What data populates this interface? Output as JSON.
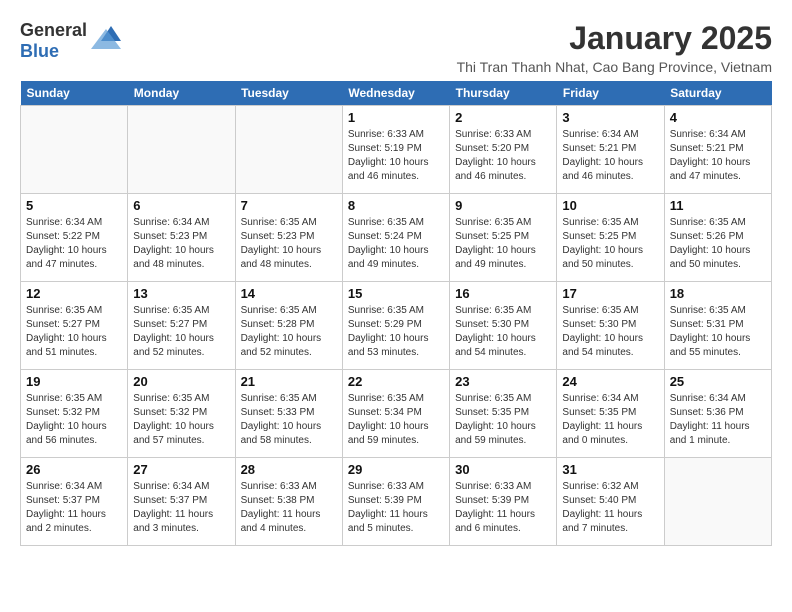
{
  "header": {
    "logo_general": "General",
    "logo_blue": "Blue",
    "title": "January 2025",
    "subtitle": "Thi Tran Thanh Nhat, Cao Bang Province, Vietnam"
  },
  "days": [
    "Sunday",
    "Monday",
    "Tuesday",
    "Wednesday",
    "Thursday",
    "Friday",
    "Saturday"
  ],
  "weeks": [
    [
      {
        "date": "",
        "info": ""
      },
      {
        "date": "",
        "info": ""
      },
      {
        "date": "",
        "info": ""
      },
      {
        "date": "1",
        "info": "Sunrise: 6:33 AM\nSunset: 5:19 PM\nDaylight: 10 hours\nand 46 minutes."
      },
      {
        "date": "2",
        "info": "Sunrise: 6:33 AM\nSunset: 5:20 PM\nDaylight: 10 hours\nand 46 minutes."
      },
      {
        "date": "3",
        "info": "Sunrise: 6:34 AM\nSunset: 5:21 PM\nDaylight: 10 hours\nand 46 minutes."
      },
      {
        "date": "4",
        "info": "Sunrise: 6:34 AM\nSunset: 5:21 PM\nDaylight: 10 hours\nand 47 minutes."
      }
    ],
    [
      {
        "date": "5",
        "info": "Sunrise: 6:34 AM\nSunset: 5:22 PM\nDaylight: 10 hours\nand 47 minutes."
      },
      {
        "date": "6",
        "info": "Sunrise: 6:34 AM\nSunset: 5:23 PM\nDaylight: 10 hours\nand 48 minutes."
      },
      {
        "date": "7",
        "info": "Sunrise: 6:35 AM\nSunset: 5:23 PM\nDaylight: 10 hours\nand 48 minutes."
      },
      {
        "date": "8",
        "info": "Sunrise: 6:35 AM\nSunset: 5:24 PM\nDaylight: 10 hours\nand 49 minutes."
      },
      {
        "date": "9",
        "info": "Sunrise: 6:35 AM\nSunset: 5:25 PM\nDaylight: 10 hours\nand 49 minutes."
      },
      {
        "date": "10",
        "info": "Sunrise: 6:35 AM\nSunset: 5:25 PM\nDaylight: 10 hours\nand 50 minutes."
      },
      {
        "date": "11",
        "info": "Sunrise: 6:35 AM\nSunset: 5:26 PM\nDaylight: 10 hours\nand 50 minutes."
      }
    ],
    [
      {
        "date": "12",
        "info": "Sunrise: 6:35 AM\nSunset: 5:27 PM\nDaylight: 10 hours\nand 51 minutes."
      },
      {
        "date": "13",
        "info": "Sunrise: 6:35 AM\nSunset: 5:27 PM\nDaylight: 10 hours\nand 52 minutes."
      },
      {
        "date": "14",
        "info": "Sunrise: 6:35 AM\nSunset: 5:28 PM\nDaylight: 10 hours\nand 52 minutes."
      },
      {
        "date": "15",
        "info": "Sunrise: 6:35 AM\nSunset: 5:29 PM\nDaylight: 10 hours\nand 53 minutes."
      },
      {
        "date": "16",
        "info": "Sunrise: 6:35 AM\nSunset: 5:30 PM\nDaylight: 10 hours\nand 54 minutes."
      },
      {
        "date": "17",
        "info": "Sunrise: 6:35 AM\nSunset: 5:30 PM\nDaylight: 10 hours\nand 54 minutes."
      },
      {
        "date": "18",
        "info": "Sunrise: 6:35 AM\nSunset: 5:31 PM\nDaylight: 10 hours\nand 55 minutes."
      }
    ],
    [
      {
        "date": "19",
        "info": "Sunrise: 6:35 AM\nSunset: 5:32 PM\nDaylight: 10 hours\nand 56 minutes."
      },
      {
        "date": "20",
        "info": "Sunrise: 6:35 AM\nSunset: 5:32 PM\nDaylight: 10 hours\nand 57 minutes."
      },
      {
        "date": "21",
        "info": "Sunrise: 6:35 AM\nSunset: 5:33 PM\nDaylight: 10 hours\nand 58 minutes."
      },
      {
        "date": "22",
        "info": "Sunrise: 6:35 AM\nSunset: 5:34 PM\nDaylight: 10 hours\nand 59 minutes."
      },
      {
        "date": "23",
        "info": "Sunrise: 6:35 AM\nSunset: 5:35 PM\nDaylight: 10 hours\nand 59 minutes."
      },
      {
        "date": "24",
        "info": "Sunrise: 6:34 AM\nSunset: 5:35 PM\nDaylight: 11 hours\nand 0 minutes."
      },
      {
        "date": "25",
        "info": "Sunrise: 6:34 AM\nSunset: 5:36 PM\nDaylight: 11 hours\nand 1 minute."
      }
    ],
    [
      {
        "date": "26",
        "info": "Sunrise: 6:34 AM\nSunset: 5:37 PM\nDaylight: 11 hours\nand 2 minutes."
      },
      {
        "date": "27",
        "info": "Sunrise: 6:34 AM\nSunset: 5:37 PM\nDaylight: 11 hours\nand 3 minutes."
      },
      {
        "date": "28",
        "info": "Sunrise: 6:33 AM\nSunset: 5:38 PM\nDaylight: 11 hours\nand 4 minutes."
      },
      {
        "date": "29",
        "info": "Sunrise: 6:33 AM\nSunset: 5:39 PM\nDaylight: 11 hours\nand 5 minutes."
      },
      {
        "date": "30",
        "info": "Sunrise: 6:33 AM\nSunset: 5:39 PM\nDaylight: 11 hours\nand 6 minutes."
      },
      {
        "date": "31",
        "info": "Sunrise: 6:32 AM\nSunset: 5:40 PM\nDaylight: 11 hours\nand 7 minutes."
      },
      {
        "date": "",
        "info": ""
      }
    ]
  ]
}
